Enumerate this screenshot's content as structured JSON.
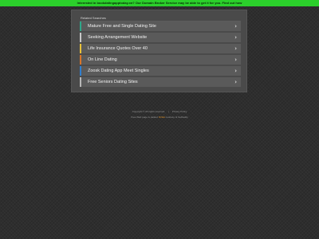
{
  "banner": {
    "text": "Interested in bookdatingapptoday.xn? Our Domain Broker Service may be able to get it for you. Find out how"
  },
  "panel": {
    "title": "Related Searches"
  },
  "searches": [
    {
      "label": "Mature Free and Single Dating Site",
      "accent": "#2fa88a"
    },
    {
      "label": "Seeking Arrangement Website",
      "accent": "#c8c8c8"
    },
    {
      "label": "Life Insurance Quotes Over 40",
      "accent": "#e8c23a"
    },
    {
      "label": "On Line Dating",
      "accent": "#d8752a"
    },
    {
      "label": "Zoosk Dating App Meet Singles",
      "accent": "#2f7fd0"
    },
    {
      "label": "Free Seniors Dating Sites",
      "accent": "#b8b8b8"
    }
  ],
  "icons": {
    "chevron": "chevron-right-icon"
  },
  "footer": {
    "copyright": "Copyright ©  All rights reserved.",
    "privacy": "Privacy Policy",
    "prefix": "Free Web page is parked",
    "link": "FREE",
    "suffix": "courtesy of GoDaddy"
  }
}
